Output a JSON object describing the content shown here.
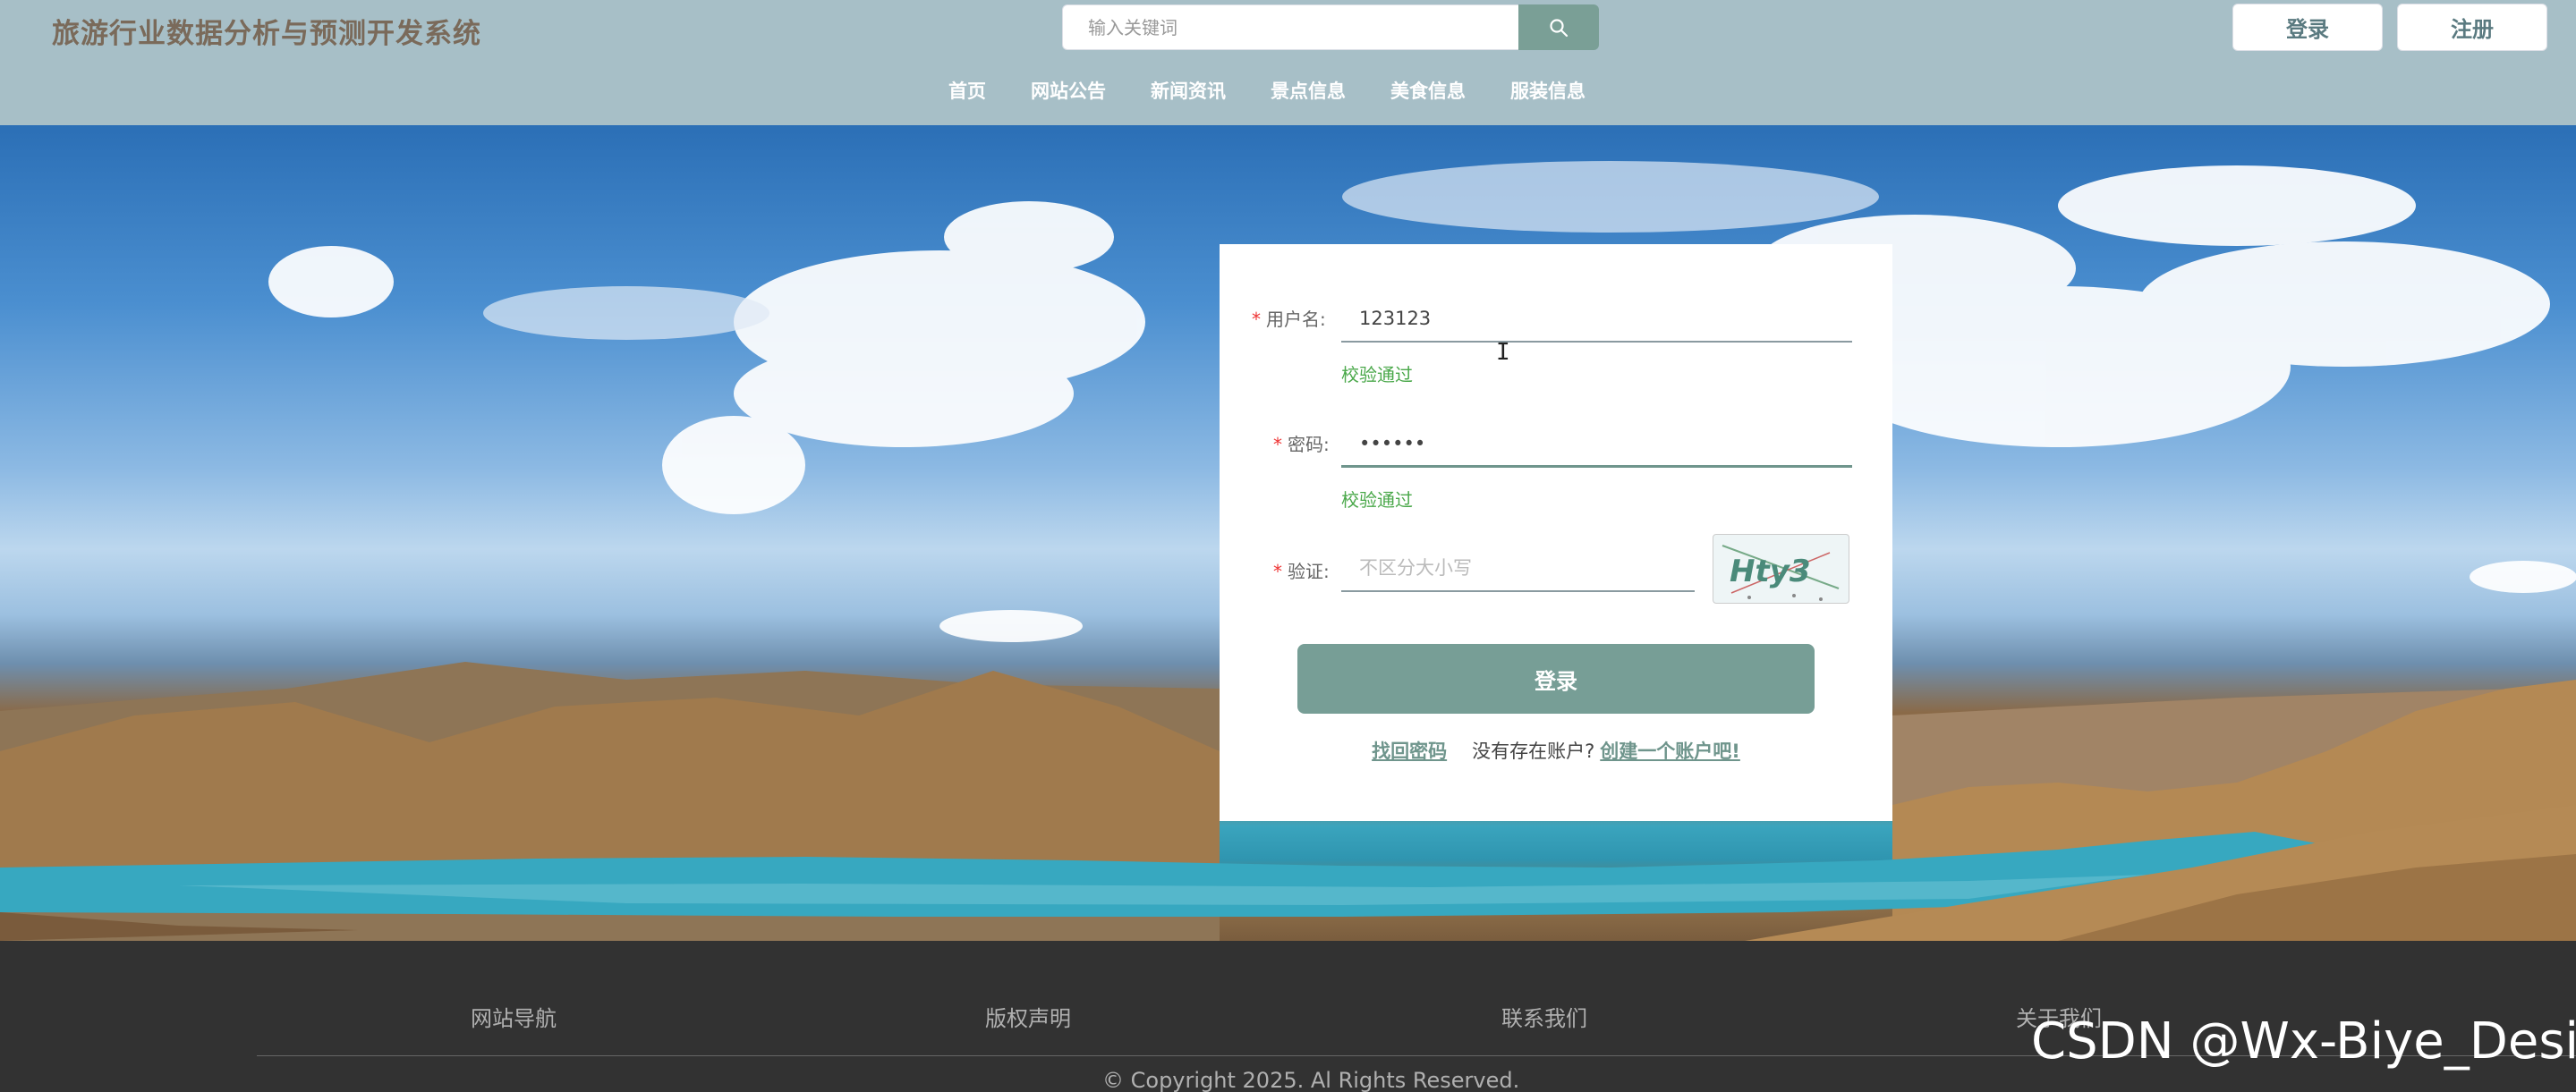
{
  "header": {
    "site_title": "旅游行业数据分析与预测开发系统",
    "search_placeholder": "输入关键词",
    "login_label": "登录",
    "register_label": "注册"
  },
  "nav": {
    "items": [
      "首页",
      "网站公告",
      "新闻资讯",
      "景点信息",
      "美食信息",
      "服装信息"
    ]
  },
  "login_form": {
    "username_label": "用户名:",
    "username_value": "123123",
    "username_status": "校验通过",
    "password_label": "密码:",
    "password_value": "••••••",
    "password_status": "校验通过",
    "captcha_label": "验证:",
    "captcha_placeholder": "不区分大小写",
    "captcha_text": "Hty3",
    "required_mark": "*",
    "submit_label": "登录",
    "forgot_password": "找回密码",
    "no_account_text": "没有存在账户?",
    "create_account": "创建一个账户吧!"
  },
  "footer": {
    "links": [
      "网站导航",
      "版权声明",
      "联系我们",
      "关于我们"
    ],
    "copyright": "© Copyright 2025. Al Rights Reserved."
  },
  "watermark": "CSDN @Wx-Biye_Design",
  "colors": {
    "header_bg": "#a7bfc7",
    "accent": "#779e96",
    "success": "#4aa84a",
    "footer_bg": "#323232"
  }
}
